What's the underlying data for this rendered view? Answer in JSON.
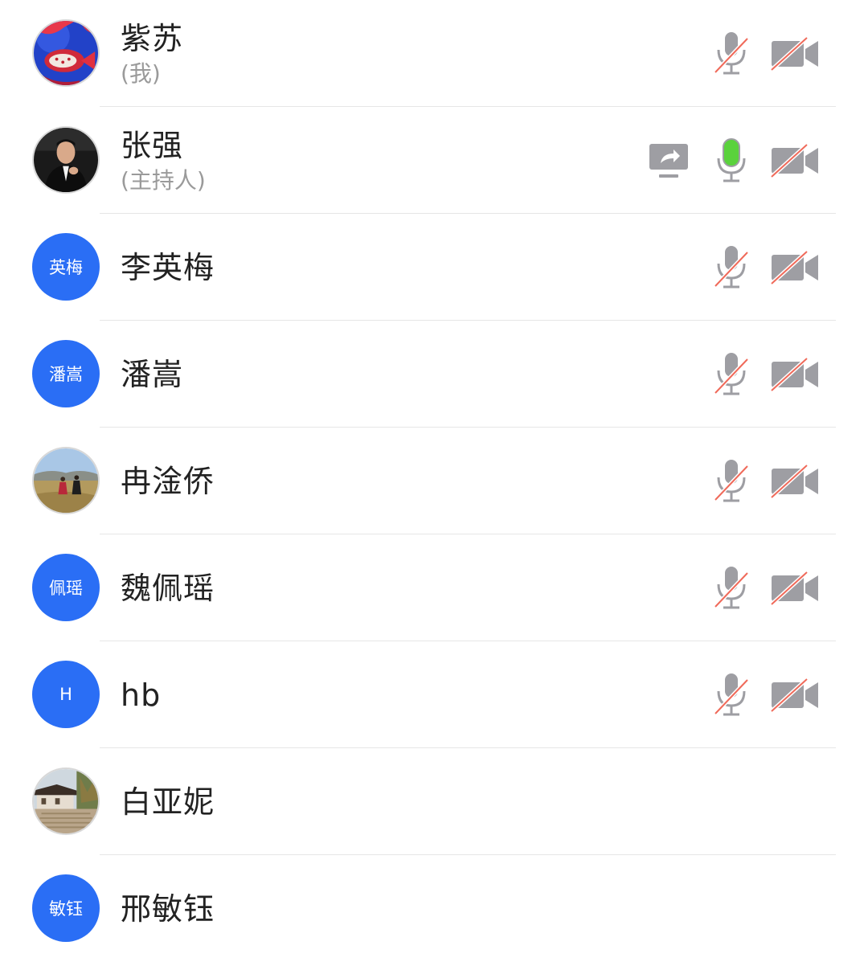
{
  "participants": [
    {
      "name": "紫苏",
      "subtitle": "(我)",
      "avatar_type": "photo",
      "avatar_icon": "fish-photo-avatar",
      "mic": "muted",
      "camera": "off",
      "sharing": false
    },
    {
      "name": "张强",
      "subtitle": "(主持人)",
      "avatar_type": "photo",
      "avatar_icon": "portrait-photo-avatar",
      "mic": "active",
      "camera": "off",
      "sharing": true
    },
    {
      "name": "李英梅",
      "subtitle": "",
      "avatar_type": "text",
      "avatar_text": "英梅",
      "mic": "muted",
      "camera": "off",
      "sharing": false
    },
    {
      "name": "潘嵩",
      "subtitle": "",
      "avatar_type": "text",
      "avatar_text": "潘嵩",
      "mic": "muted",
      "camera": "off",
      "sharing": false
    },
    {
      "name": "冉淦侨",
      "subtitle": "",
      "avatar_type": "photo",
      "avatar_icon": "grassland-photo-avatar",
      "mic": "muted",
      "camera": "off",
      "sharing": false
    },
    {
      "name": "魏佩瑶",
      "subtitle": "",
      "avatar_type": "text",
      "avatar_text": "佩瑶",
      "mic": "muted",
      "camera": "off",
      "sharing": false
    },
    {
      "name": "hb",
      "subtitle": "",
      "avatar_type": "text",
      "avatar_text": "H",
      "mic": "muted",
      "camera": "off",
      "sharing": false
    },
    {
      "name": "白亚妮",
      "subtitle": "",
      "avatar_type": "photo",
      "avatar_icon": "building-photo-avatar",
      "mic": "none",
      "camera": "none",
      "sharing": false
    },
    {
      "name": "邢敏钰",
      "subtitle": "",
      "avatar_type": "text",
      "avatar_text": "敏钰",
      "mic": "none",
      "camera": "none",
      "sharing": false
    }
  ],
  "colors": {
    "avatar_blue": "#2a6ef5",
    "icon_gray": "#9e9ea3",
    "mute_red": "#f06a5a",
    "mic_active_green": "#5ad23c",
    "divider": "#e6e6e6",
    "subtitle_gray": "#9a9a9a"
  },
  "icons": {
    "mic": "microphone-icon",
    "camera": "video-camera-icon",
    "share": "screen-share-icon"
  }
}
